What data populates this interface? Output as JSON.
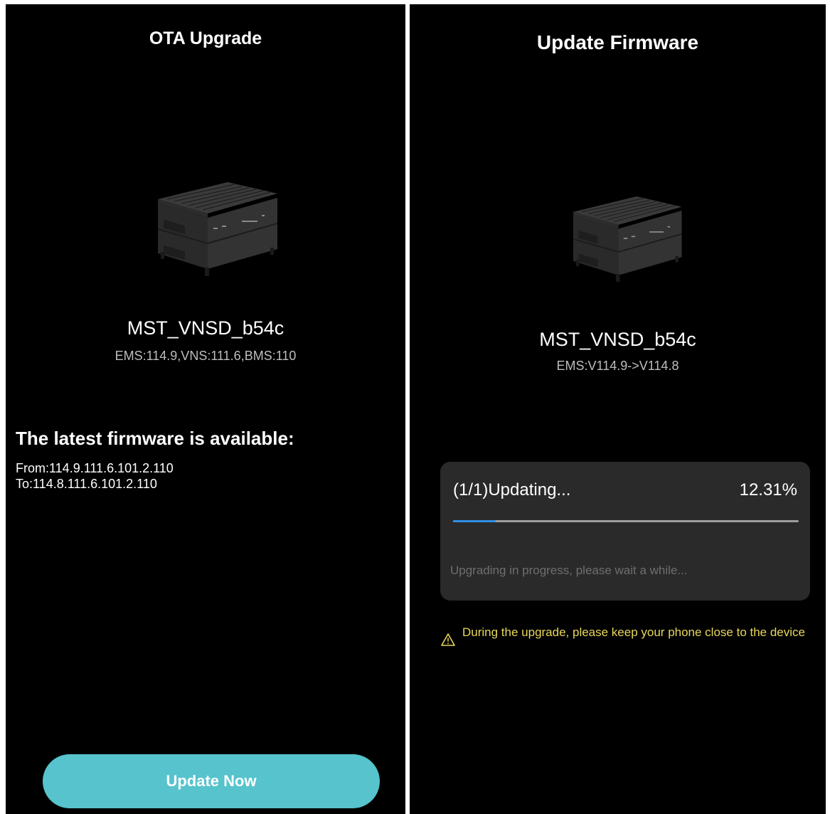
{
  "left_screen": {
    "title": "OTA Upgrade",
    "device_icon": "energy-storage-unit-image",
    "device_name": "MST_VNSD_b54c",
    "device_versions": "EMS:114.9,VNS:111.6,BMS:110",
    "available_heading": "The latest firmware is available:",
    "firmware_from": "From:114.9.111.6.101.2.110",
    "firmware_to": "To:114.8.111.6.101.2.110",
    "update_button_label": "Update Now",
    "button_color": "#56c3cd"
  },
  "right_screen": {
    "title": "Update Firmware",
    "device_icon": "energy-storage-unit-image",
    "device_name": "MST_VNSD_b54c",
    "version_change": "EMS:V114.9->V114.8",
    "progress": {
      "label": "(1/1)Updating...",
      "percent_text": "12.31%",
      "fraction": 0.1231,
      "note": "Upgrading in progress, please wait a while...",
      "bar_color": "#2f8fe4"
    },
    "warning": {
      "icon": "warning-triangle-icon",
      "text": "During the upgrade, please keep your phone close to the device",
      "color": "#e8d75a"
    }
  }
}
